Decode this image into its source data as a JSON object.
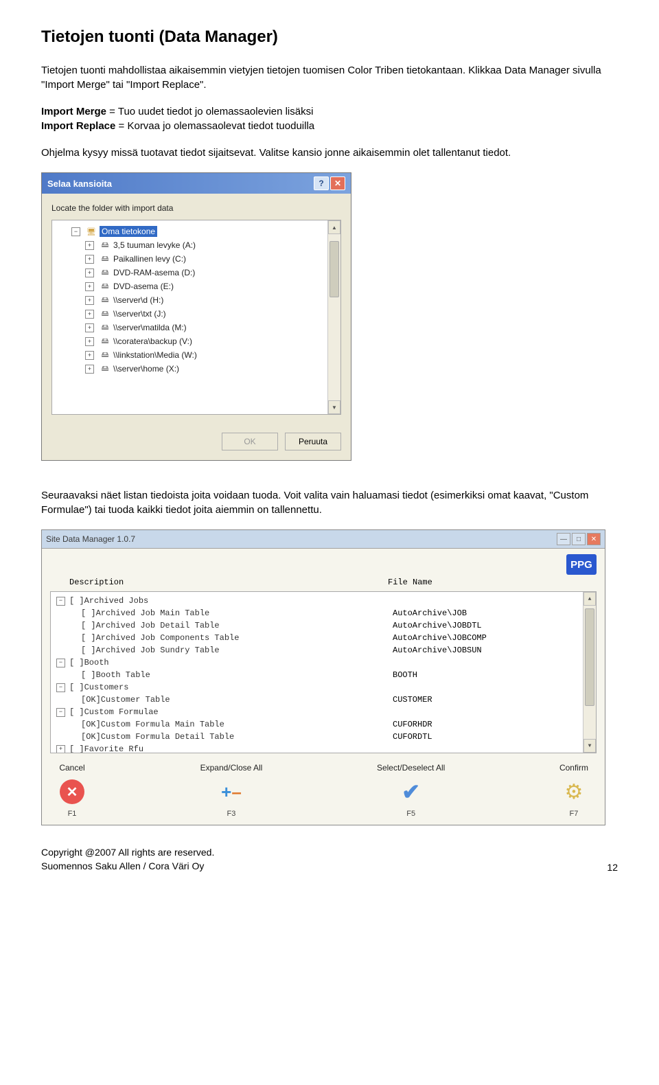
{
  "heading": "Tietojen tuonti (Data Manager)",
  "para1": "Tietojen tuonti mahdollistaa aikaisemmin vietyjen tietojen tuomisen Color Triben tietokantaan. Klikkaa Data Manager sivulla \"Import Merge\" tai \"Import Replace\".",
  "line_merge_label": "Import Merge",
  "line_merge_text": " = Tuo uudet tiedot jo olemassaolevien lisäksi",
  "line_replace_label": "Import Replace",
  "line_replace_text": " = Korvaa jo olemassaolevat tiedot tuoduilla",
  "para2": "Ohjelma kysyy missä tuotavat tiedot sijaitsevat. Valitse kansio jonne aikaisemmin olet tallentanut tiedot.",
  "dialog1": {
    "title": "Selaa kansioita",
    "prompt": "Locate the folder with import data",
    "root": "Oma tietokone",
    "items": [
      "3,5 tuuman levyke (A:)",
      "Paikallinen levy (C:)",
      "DVD-RAM-asema (D:)",
      "DVD-asema (E:)",
      "\\\\server\\d (H:)",
      "\\\\server\\txt (J:)",
      "\\\\server\\matilda (M:)",
      "\\\\coratera\\backup (V:)",
      "\\\\linkstation\\Media (W:)",
      "\\\\server\\home (X:)"
    ],
    "ok": "OK",
    "cancel": "Peruuta"
  },
  "para3": "Seuraavaksi näet listan tiedoista joita voidaan tuoda. Voit valita vain haluamasi tiedot (esimerkiksi omat kaavat, \"Custom Formulae\") tai tuoda kaikki tiedot joita aiemmin on tallennettu.",
  "app": {
    "title": "Site Data Manager 1.0.7",
    "logo": "PPG",
    "col_desc": "Description",
    "col_file": "File Name",
    "rows": [
      {
        "type": "group",
        "exp": "−",
        "label": "[ ]Archived Jobs"
      },
      {
        "type": "item",
        "label": "[ ]Archived Job Main Table",
        "file": "AutoArchive\\JOB"
      },
      {
        "type": "item",
        "label": "[ ]Archived Job Detail Table",
        "file": "AutoArchive\\JOBDTL"
      },
      {
        "type": "item",
        "label": "[ ]Archived Job Components Table",
        "file": "AutoArchive\\JOBCOMP"
      },
      {
        "type": "item",
        "label": "[ ]Archived Job Sundry Table",
        "file": "AutoArchive\\JOBSUN"
      },
      {
        "type": "group",
        "exp": "−",
        "label": "[ ]Booth"
      },
      {
        "type": "item",
        "label": "[ ]Booth Table",
        "file": "BOOTH"
      },
      {
        "type": "group",
        "exp": "−",
        "label": "[ ]Customers"
      },
      {
        "type": "item",
        "label": "[OK]Customer Table",
        "file": "CUSTOMER"
      },
      {
        "type": "group",
        "exp": "−",
        "label": "[ ]Custom Formulae"
      },
      {
        "type": "item",
        "label": "[OK]Custom Formula Main Table",
        "file": "CUFORHDR"
      },
      {
        "type": "item",
        "label": "[OK]Custom Formula Detail Table",
        "file": "CUFORDTL"
      },
      {
        "type": "group",
        "exp": "+",
        "label": "[ ]Favorite Rfu"
      }
    ],
    "actions": {
      "cancel": {
        "label": "Cancel",
        "key": "F1"
      },
      "expand": {
        "label": "Expand/Close All",
        "key": "F3"
      },
      "select": {
        "label": "Select/Deselect All",
        "key": "F5"
      },
      "confirm": {
        "label": "Confirm",
        "key": "F7"
      }
    }
  },
  "footer": {
    "copyright": "Copyright @2007   All rights are reserved.",
    "translation": "Suomennos Saku Allen / Cora Väri Oy",
    "page": "12"
  }
}
